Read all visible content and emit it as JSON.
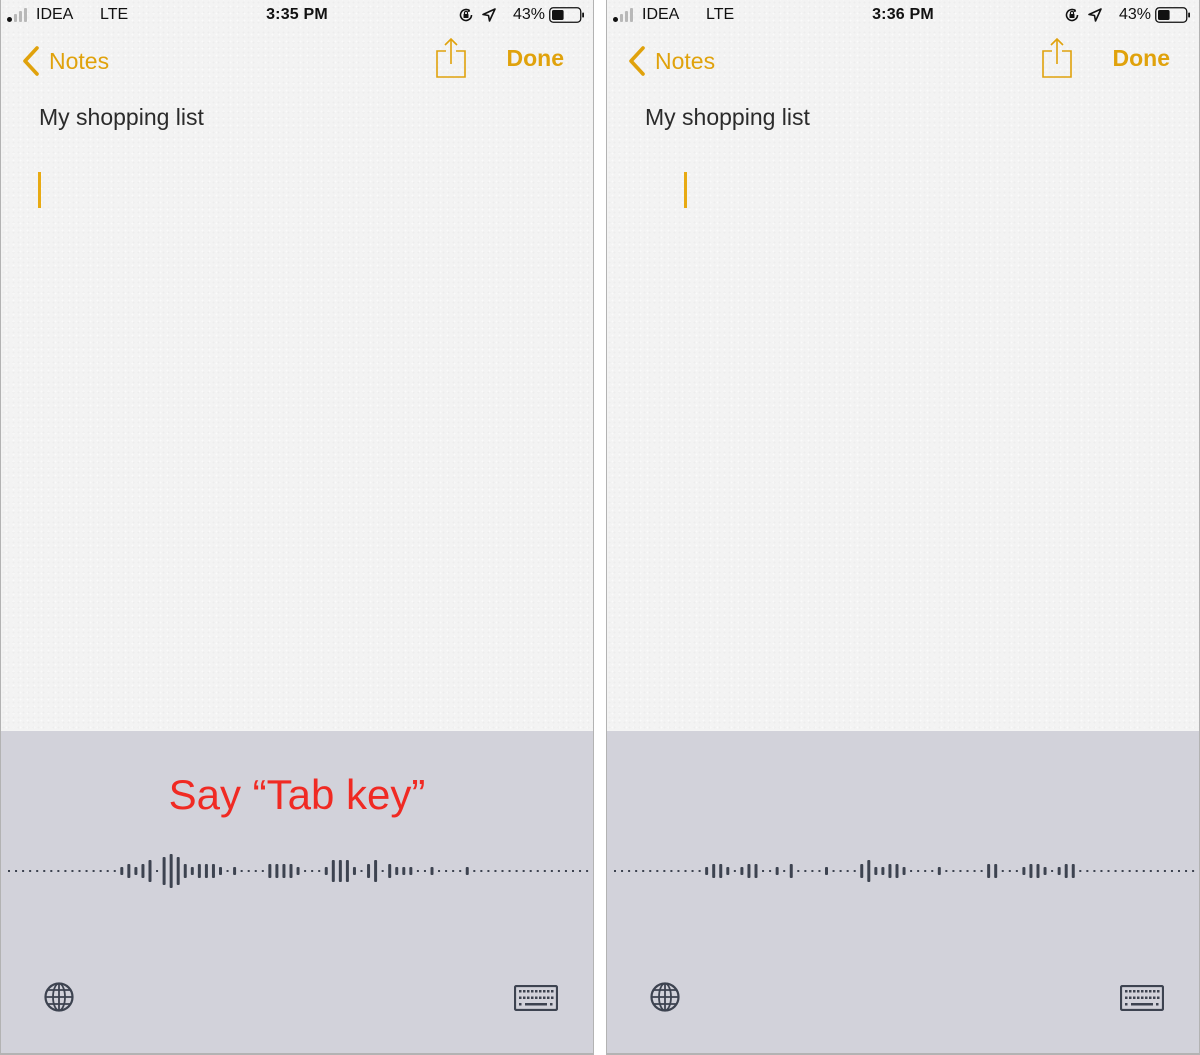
{
  "colors": {
    "accent": "#e0a20c",
    "cursor": "#e8aa13",
    "hint": "#f02a23",
    "dictation_bg": "#d2d2da",
    "waveform": "#3d4350"
  },
  "screens": [
    {
      "id": "left",
      "status_bar": {
        "carrier": "IDEA",
        "network": "LTE",
        "time": "3:35 PM",
        "battery_percent": "43%",
        "battery_level": 0.43,
        "signal_strength": 1,
        "icons": [
          "signal-icon",
          "orientation-lock-icon",
          "location-arrow-icon",
          "battery-icon"
        ]
      },
      "nav": {
        "back_label": "Notes",
        "done_label": "Done",
        "share_icon": "share-icon"
      },
      "note": {
        "title": "My shopping list",
        "cursor_indented": false
      },
      "dictation": {
        "hint": "Say “Tab key”",
        "waveform_levels": [
          0,
          0,
          0,
          0,
          0,
          0,
          0,
          0,
          0,
          0,
          0,
          0,
          0,
          0,
          0,
          0,
          1,
          2,
          1,
          2,
          3,
          0,
          4,
          5,
          4,
          2,
          1,
          2,
          2,
          2,
          1,
          0,
          1,
          0,
          0,
          0,
          0,
          2,
          2,
          2,
          2,
          1,
          0,
          0,
          0,
          1,
          3,
          3,
          3,
          1,
          0,
          2,
          3,
          0,
          2,
          1,
          1,
          1,
          0,
          0,
          1,
          0,
          0,
          0,
          0,
          1,
          0,
          0,
          0,
          0,
          0,
          0,
          0,
          0,
          0,
          0,
          0,
          0,
          0,
          0,
          0,
          0,
          0
        ],
        "globe_icon": "globe-icon",
        "keyboard_icon": "keyboard-icon"
      }
    },
    {
      "id": "right",
      "status_bar": {
        "carrier": "IDEA",
        "network": "LTE",
        "time": "3:36 PM",
        "battery_percent": "43%",
        "battery_level": 0.43,
        "signal_strength": 1,
        "icons": [
          "signal-icon",
          "orientation-lock-icon",
          "location-arrow-icon",
          "battery-icon"
        ]
      },
      "nav": {
        "back_label": "Notes",
        "done_label": "Done",
        "share_icon": "share-icon"
      },
      "note": {
        "title": "My shopping list",
        "cursor_indented": true
      },
      "dictation": {
        "hint": "",
        "waveform_levels": [
          0,
          0,
          0,
          0,
          0,
          0,
          0,
          0,
          0,
          0,
          0,
          0,
          0,
          1,
          2,
          2,
          1,
          0,
          1,
          2,
          2,
          0,
          0,
          1,
          0,
          2,
          0,
          0,
          0,
          0,
          1,
          0,
          0,
          0,
          0,
          2,
          3,
          1,
          1,
          2,
          2,
          1,
          0,
          0,
          0,
          0,
          1,
          0,
          0,
          0,
          0,
          0,
          0,
          2,
          2,
          0,
          0,
          0,
          1,
          2,
          2,
          1,
          0,
          1,
          2,
          2,
          0,
          0,
          0,
          0,
          0,
          0,
          0,
          0,
          0,
          0,
          0,
          0,
          0,
          0,
          0,
          0,
          0,
          0
        ],
        "globe_icon": "globe-icon",
        "keyboard_icon": "keyboard-icon"
      }
    }
  ]
}
